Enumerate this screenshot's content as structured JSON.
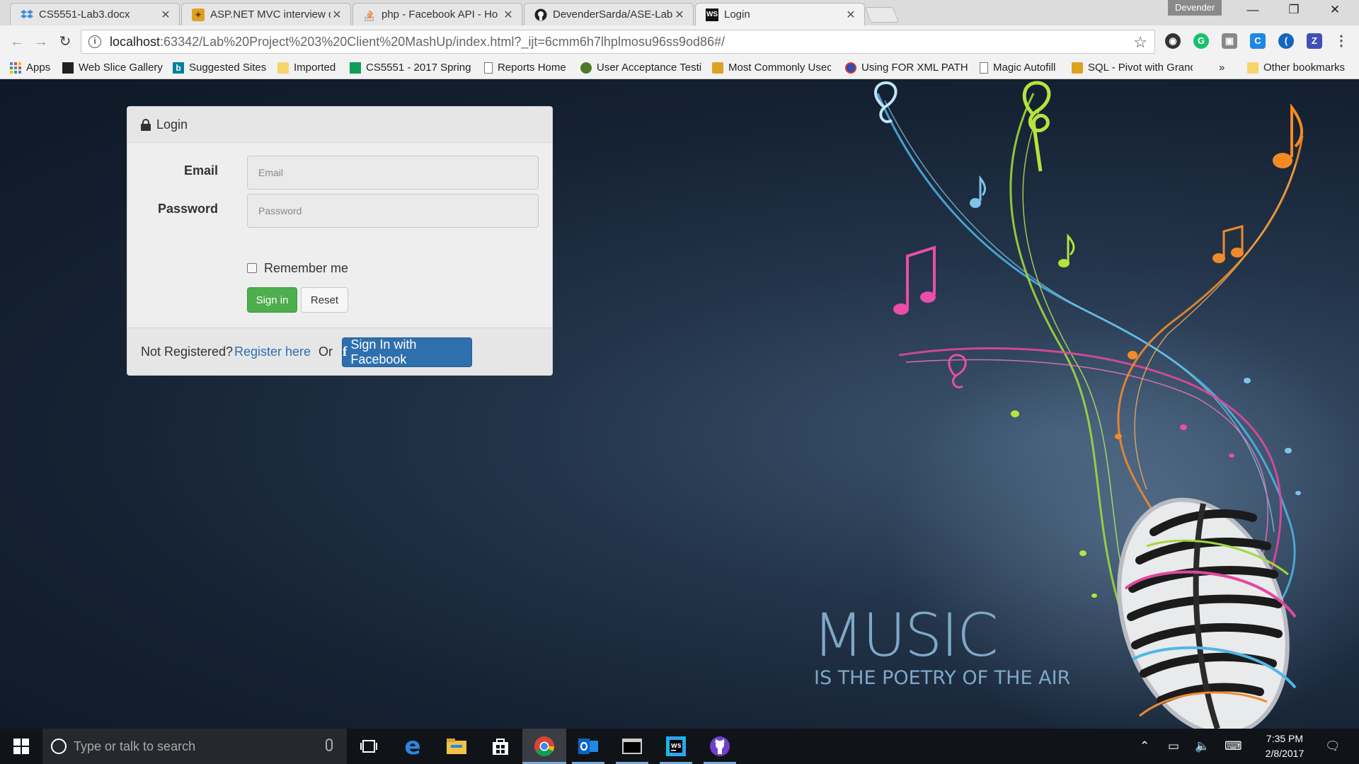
{
  "browser": {
    "tabs": [
      {
        "title": "CS5551-Lab3.docx",
        "icon": "dropbox-icon"
      },
      {
        "title": "ASP.NET MVC interview q",
        "icon": "bulb-icon"
      },
      {
        "title": "php - Facebook API - Ho",
        "icon": "stackoverflow-icon"
      },
      {
        "title": "DevenderSarda/ASE-Lab",
        "icon": "github-icon"
      },
      {
        "title": "Login",
        "icon": "webstorm-icon"
      }
    ],
    "profile_name": "Devender",
    "url_host": "localhost",
    "url_rest": ":63342/Lab%20Project%203%20Client%20MashUp/index.html?_ijt=6cmm6h7lhplmosu96ss9od86#/",
    "bookmarks": [
      {
        "label": "Apps",
        "icon": "apps-grid-icon"
      },
      {
        "label": "Web Slice Gallery",
        "icon": "web-slice-icon"
      },
      {
        "label": "Suggested Sites",
        "icon": "bing-icon"
      },
      {
        "label": "Imported",
        "icon": "folder-icon"
      },
      {
        "label": "CS5551 - 2017 Spring",
        "icon": "sheet-icon"
      },
      {
        "label": "Reports Home",
        "icon": "page-icon"
      },
      {
        "label": "User Acceptance Testi",
        "icon": "bug-icon"
      },
      {
        "label": "Most Commonly Usec",
        "icon": "bulb-icon"
      },
      {
        "label": "Using FOR XML PATH",
        "icon": "globe-icon"
      },
      {
        "label": "Magic Autofill",
        "icon": "page-icon"
      },
      {
        "label": "SQL - Pivot with Grand",
        "icon": "bulb-icon"
      }
    ],
    "overflow": "»",
    "other_bookmarks": "Other bookmarks"
  },
  "login": {
    "heading": "Login",
    "email_label": "Email",
    "email_placeholder": "Email",
    "password_label": "Password",
    "password_placeholder": "Password",
    "remember_label": "Remember me",
    "remember_checked": false,
    "signin_label": "Sign in",
    "reset_label": "Reset",
    "not_registered": "Not Registered?",
    "register_link": "Register here",
    "or_text": "Or",
    "facebook_label": "Sign In with Facebook"
  },
  "background": {
    "headline": "MUSIC",
    "tagline": "IS THE POETRY OF THE AIR"
  },
  "taskbar": {
    "search_placeholder": "Type or talk to search",
    "time": "7:35 PM",
    "date": "2/8/2017",
    "apps": [
      "task-view-icon",
      "edge-icon",
      "file-explorer-icon",
      "store-icon",
      "chrome-icon",
      "outlook-icon",
      "terminal-icon",
      "webstorm-icon",
      "github-desktop-icon"
    ]
  },
  "colors": {
    "accent_green": "#4cae4c",
    "facebook_blue": "#2e6fae",
    "link_blue": "#2a6fb4"
  }
}
